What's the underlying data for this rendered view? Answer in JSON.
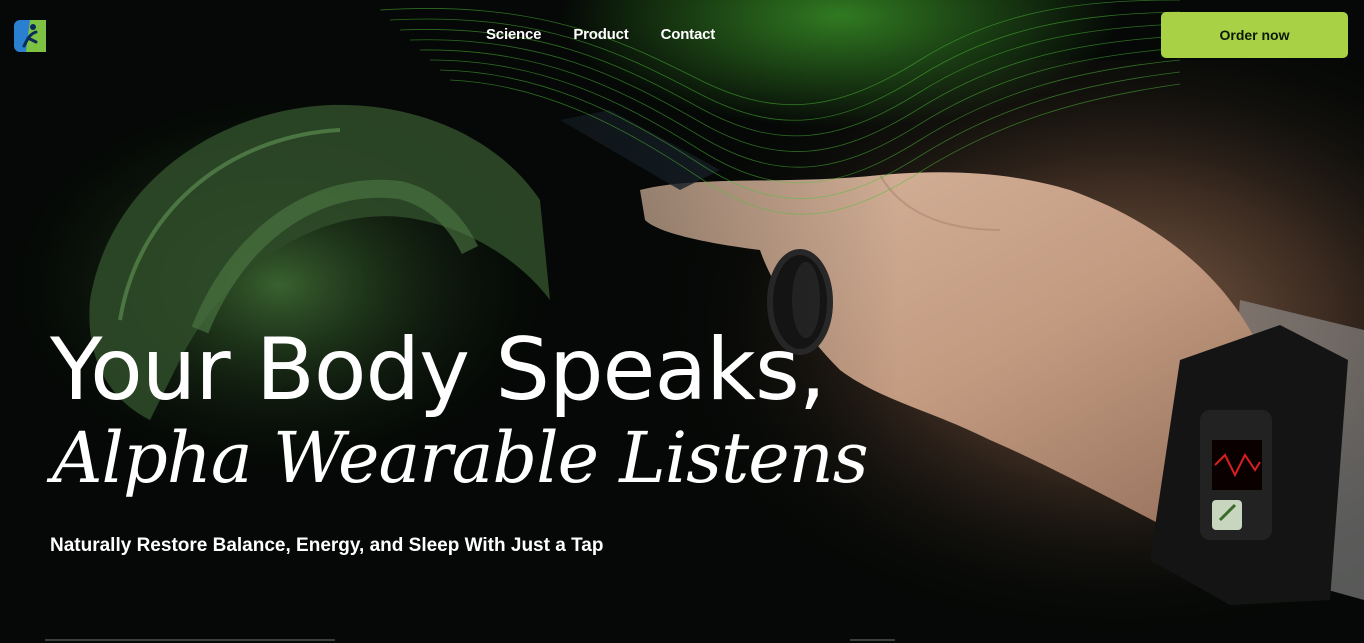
{
  "brand": {
    "logo_icon": "runner-leaf-logo-icon"
  },
  "nav": {
    "links": [
      "Science",
      "Product",
      "Contact"
    ],
    "cta_label": "Order now"
  },
  "hero": {
    "headline_line1": "Your Body Speaks,",
    "headline_line2": "Alpha Wearable Listens",
    "subtitle": "Naturally Restore Balance, Energy, and Sleep With Just a Tap"
  },
  "colors": {
    "accent": "#a8d146",
    "background": "#050806",
    "glow_green": "#3fa02a",
    "text": "#ffffff"
  }
}
